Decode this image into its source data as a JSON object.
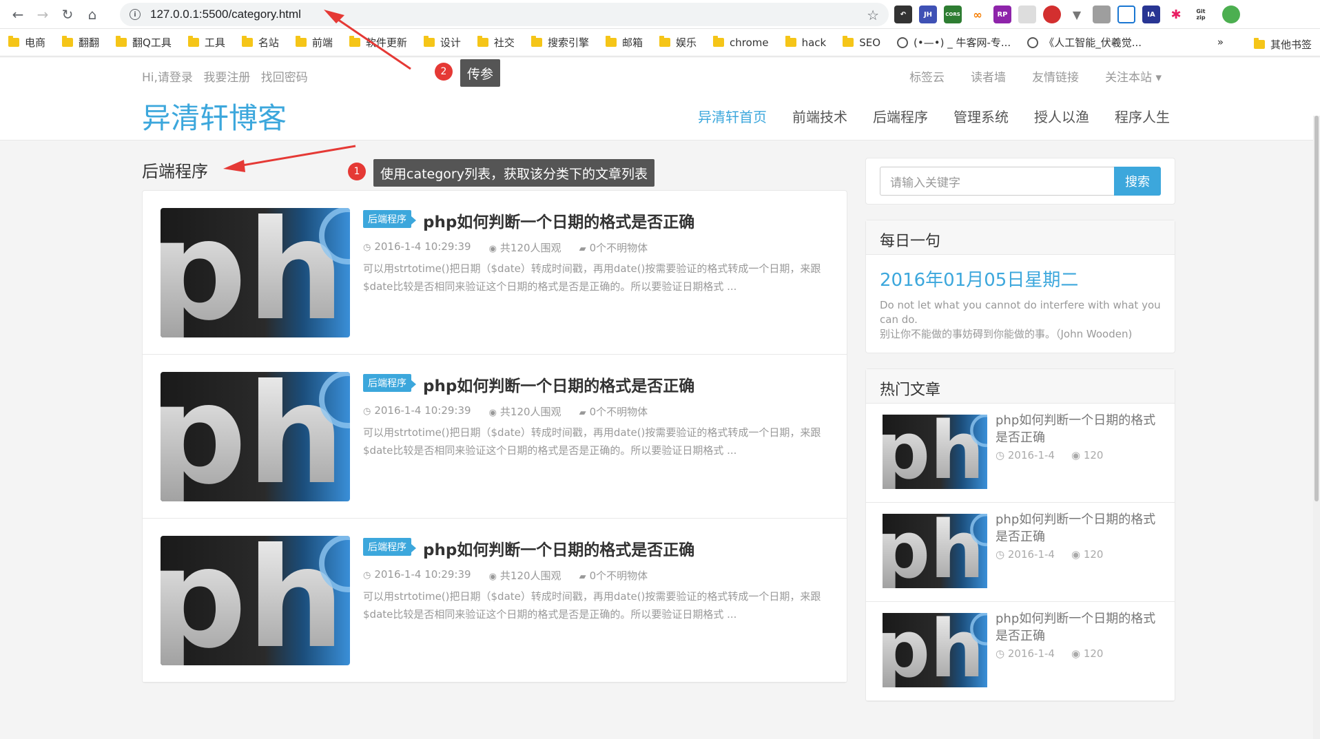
{
  "browser": {
    "url": "127.0.0.1:5500/category.html",
    "bookmarks": [
      "电商",
      "翻翻",
      "翻Q工具",
      "工具",
      "名站",
      "前端",
      "软件更新",
      "设计",
      "社交",
      "搜索引擎",
      "邮箱",
      "娱乐",
      "chrome",
      "hack",
      "SEO"
    ],
    "bookmark_sites": [
      "(•—•) _ 牛客网-专...",
      "《人工智能_伏羲觉..."
    ],
    "more": "»",
    "other_bookmarks": "其他书签",
    "extensions": [
      "JH",
      "CORS",
      "∞",
      "RP",
      "IA",
      "Git zip"
    ]
  },
  "header": {
    "login": "Hi,请登录",
    "register": "我要注册",
    "recover": "找回密码",
    "right_links": [
      "标签云",
      "读者墙",
      "友情链接",
      "关注本站 ▾"
    ],
    "logo": "异清轩博客",
    "nav": [
      "异清轩首页",
      "前端技术",
      "后端程序",
      "管理系统",
      "授人以渔",
      "程序人生"
    ]
  },
  "category": {
    "title": "后端程序",
    "articles": [
      {
        "tag": "后端程序",
        "title": "php如何判断一个日期的格式是否正确",
        "date": "2016-1-4 10:29:39",
        "views": "共120人围观",
        "comments": "0个不明物体",
        "excerpt": "可以用strtotime()把日期（$date）转成时间戳，再用date()按需要验证的格式转成一个日期，来跟$date比较是否相同来验证这个日期的格式是否是正确的。所以要验证日期格式 ..."
      },
      {
        "tag": "后端程序",
        "title": "php如何判断一个日期的格式是否正确",
        "date": "2016-1-4 10:29:39",
        "views": "共120人围观",
        "comments": "0个不明物体",
        "excerpt": "可以用strtotime()把日期（$date）转成时间戳，再用date()按需要验证的格式转成一个日期，来跟$date比较是否相同来验证这个日期的格式是否是正确的。所以要验证日期格式 ..."
      },
      {
        "tag": "后端程序",
        "title": "php如何判断一个日期的格式是否正确",
        "date": "2016-1-4 10:29:39",
        "views": "共120人围观",
        "comments": "0个不明物体",
        "excerpt": "可以用strtotime()把日期（$date）转成时间戳，再用date()按需要验证的格式转成一个日期，来跟$date比较是否相同来验证这个日期的格式是否是正确的。所以要验证日期格式 ..."
      }
    ]
  },
  "sidebar": {
    "search_placeholder": "请输入关键字",
    "search_button": "搜索",
    "daily_title": "每日一句",
    "daily_date": "2016年01月05日星期二",
    "daily_en": "Do not let what you cannot do interfere with what you can do.",
    "daily_cn": "别让你不能做的事妨碍到你能做的事。（John Wooden)",
    "hot_title": "热门文章",
    "hot": [
      {
        "title": "php如何判断一个日期的格式是否正确",
        "date": "2016-1-4",
        "views": "120"
      },
      {
        "title": "php如何判断一个日期的格式是否正确",
        "date": "2016-1-4",
        "views": "120"
      },
      {
        "title": "php如何判断一个日期的格式是否正确",
        "date": "2016-1-4",
        "views": "120"
      }
    ]
  },
  "annotations": {
    "a1_num": "1",
    "a1_text": "使用category列表，获取该分类下的文章列表",
    "a2_num": "2",
    "a2_text": "传参"
  },
  "thumb_text": "php"
}
